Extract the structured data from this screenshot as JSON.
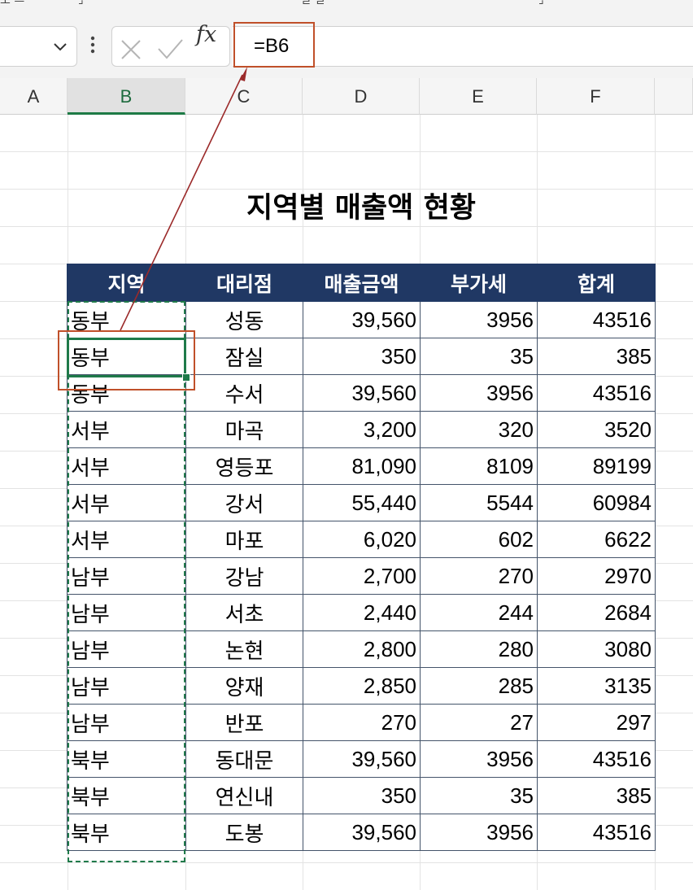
{
  "formula_bar": {
    "formula": "=B6",
    "fx_label": "fx"
  },
  "columns": [
    "A",
    "B",
    "C",
    "D",
    "E",
    "F"
  ],
  "active_column": "B",
  "sheet": {
    "title": "지역별 매출액 현황",
    "headers": [
      "지역",
      "대리점",
      "매출금액",
      "부가세",
      "합계"
    ],
    "rows": [
      [
        "동부",
        "성동",
        "39,560",
        "3956",
        "43516"
      ],
      [
        "동부",
        "잠실",
        "350",
        "35",
        "385"
      ],
      [
        "동부",
        "수서",
        "39,560",
        "3956",
        "43516"
      ],
      [
        "서부",
        "마곡",
        "3,200",
        "320",
        "3520"
      ],
      [
        "서부",
        "영등포",
        "81,090",
        "8109",
        "89199"
      ],
      [
        "서부",
        "강서",
        "55,440",
        "5544",
        "60984"
      ],
      [
        "서부",
        "마포",
        "6,020",
        "602",
        "6622"
      ],
      [
        "남부",
        "강남",
        "2,700",
        "270",
        "2970"
      ],
      [
        "남부",
        "서초",
        "2,440",
        "244",
        "2684"
      ],
      [
        "남부",
        "논현",
        "2,800",
        "280",
        "3080"
      ],
      [
        "남부",
        "양재",
        "2,850",
        "285",
        "3135"
      ],
      [
        "남부",
        "반포",
        "270",
        "27",
        "297"
      ],
      [
        "북부",
        "동대문",
        "39,560",
        "3956",
        "43516"
      ],
      [
        "북부",
        "연신내",
        "350",
        "35",
        "385"
      ],
      [
        "북부",
        "도봉",
        "39,560",
        "3956",
        "43516"
      ]
    ]
  },
  "colors": {
    "header_fill": "#203864",
    "selection_green": "#1f7a4a",
    "annotation_red": "#c0502a",
    "arrow": "#9b2a2a"
  }
}
